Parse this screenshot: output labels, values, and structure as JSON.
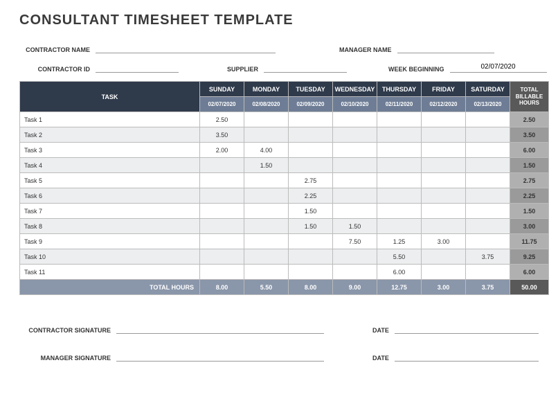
{
  "title": "CONSULTANT TIMESHEET TEMPLATE",
  "labels": {
    "contractor_name": "CONTRACTOR NAME",
    "manager_name": "MANAGER NAME",
    "contractor_id": "CONTRACTOR ID",
    "supplier": "SUPPLIER",
    "week_beginning": "WEEK BEGINNING",
    "task": "TASK",
    "total_billable_hours": "TOTAL BILLABLE HOURS",
    "total_hours": "TOTAL HOURS",
    "contractor_signature": "CONTRACTOR SIGNATURE",
    "manager_signature": "MANAGER SIGNATURE",
    "date": "DATE"
  },
  "fields": {
    "contractor_name": "",
    "manager_name": "",
    "contractor_id": "",
    "supplier": "",
    "week_beginning": "02/07/2020"
  },
  "days": [
    {
      "name": "SUNDAY",
      "date": "02/07/2020"
    },
    {
      "name": "MONDAY",
      "date": "02/08/2020"
    },
    {
      "name": "TUESDAY",
      "date": "02/09/2020"
    },
    {
      "name": "WEDNESDAY",
      "date": "02/10/2020"
    },
    {
      "name": "THURSDAY",
      "date": "02/11/2020"
    },
    {
      "name": "FRIDAY",
      "date": "02/12/2020"
    },
    {
      "name": "SATURDAY",
      "date": "02/13/2020"
    }
  ],
  "rows": [
    {
      "task": "Task 1",
      "vals": [
        "2.50",
        "",
        "",
        "",
        "",
        "",
        ""
      ],
      "total": "2.50"
    },
    {
      "task": "Task 2",
      "vals": [
        "3.50",
        "",
        "",
        "",
        "",
        "",
        ""
      ],
      "total": "3.50"
    },
    {
      "task": "Task 3",
      "vals": [
        "2.00",
        "4.00",
        "",
        "",
        "",
        "",
        ""
      ],
      "total": "6.00"
    },
    {
      "task": "Task 4",
      "vals": [
        "",
        "1.50",
        "",
        "",
        "",
        "",
        ""
      ],
      "total": "1.50"
    },
    {
      "task": "Task 5",
      "vals": [
        "",
        "",
        "2.75",
        "",
        "",
        "",
        ""
      ],
      "total": "2.75"
    },
    {
      "task": "Task 6",
      "vals": [
        "",
        "",
        "2.25",
        "",
        "",
        "",
        ""
      ],
      "total": "2.25"
    },
    {
      "task": "Task 7",
      "vals": [
        "",
        "",
        "1.50",
        "",
        "",
        "",
        ""
      ],
      "total": "1.50"
    },
    {
      "task": "Task 8",
      "vals": [
        "",
        "",
        "1.50",
        "1.50",
        "",
        "",
        ""
      ],
      "total": "3.00"
    },
    {
      "task": "Task 9",
      "vals": [
        "",
        "",
        "",
        "7.50",
        "1.25",
        "3.00",
        ""
      ],
      "total": "11.75"
    },
    {
      "task": "Task 10",
      "vals": [
        "",
        "",
        "",
        "",
        "5.50",
        "",
        "3.75"
      ],
      "total": "9.25"
    },
    {
      "task": "Task 11",
      "vals": [
        "",
        "",
        "",
        "",
        "6.00",
        "",
        ""
      ],
      "total": "6.00"
    }
  ],
  "col_totals": [
    "8.00",
    "5.50",
    "8.00",
    "9.00",
    "12.75",
    "3.00",
    "3.75"
  ],
  "grand_total": "50.00"
}
